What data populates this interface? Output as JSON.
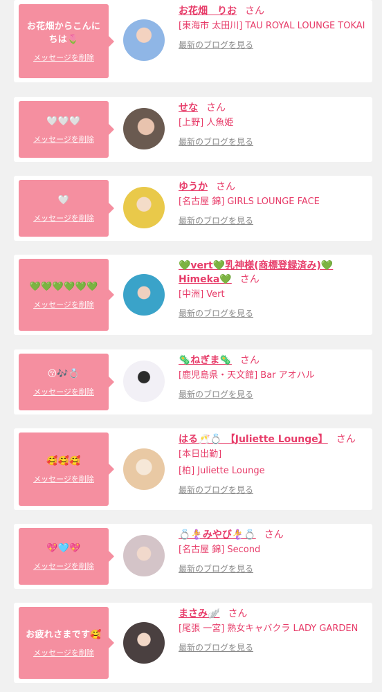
{
  "common": {
    "delete_label": "メッセージを削除",
    "san": "さん",
    "blog_link": "最新のブログを見る"
  },
  "items": [
    {
      "message": "お花畑からこんにちは🌷",
      "name": "お花畑　りお",
      "lines": [
        "[東海市 太田川] TAU ROYAL LOUNGE TOKAI"
      ]
    },
    {
      "message": "🤍🤍🤍",
      "name": "せな",
      "lines": [
        "[上野] 人魚姫"
      ]
    },
    {
      "message": "🤍",
      "name": "ゆうか",
      "lines": [
        "[名古屋 錦] GIRLS LOUNGE FACE"
      ]
    },
    {
      "message": "💚💚💚💚💚💚",
      "name": "💚vert💚乳神様(商標登録済み)💚Himeka💚",
      "lines": [
        "[中洲] Vert"
      ]
    },
    {
      "message": "😚🎶💍",
      "name": "🦠ねぎま🦠",
      "lines": [
        "[鹿児島県・天文館] Bar アオハル"
      ]
    },
    {
      "message": "🥰🥰🥰",
      "name": "はる🥂💍 【Juliette Lounge】",
      "lines": [
        "[本日出勤]",
        "[柏] Juliette Lounge"
      ]
    },
    {
      "message": "💖🩵💖",
      "name": "💍🧜‍♀️みやび🧜‍♀️💍",
      "lines": [
        "[名古屋 錦] Second"
      ]
    },
    {
      "message": "お疲れさまです🥰",
      "name": "まさみ🪽",
      "lines": [
        "[尾張 一宮] 熟女キャバクラ LADY GARDEN"
      ]
    }
  ]
}
